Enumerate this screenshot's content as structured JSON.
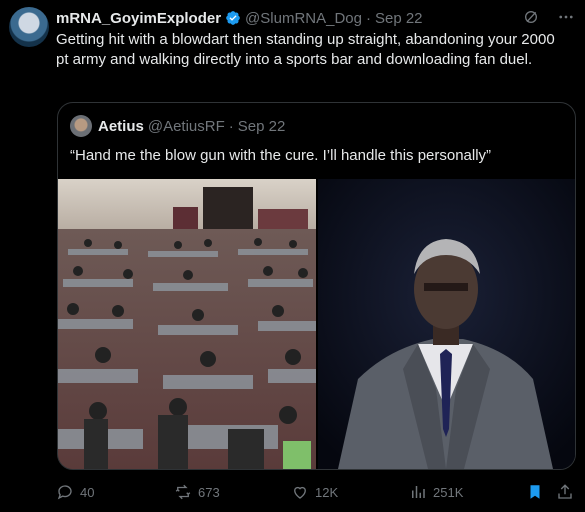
{
  "tweet": {
    "display_name": "mRNA_GoyimExploder",
    "handle": "@SlumRNA_Dog",
    "separator": "·",
    "date": "Sep 22",
    "text": "Getting hit with a blowdart then standing up straight, abandoning your 2000 pt army and walking directly into a sports bar and downloading fan duel."
  },
  "quote": {
    "display_name": "Aetius",
    "handle": "@AetiusRF",
    "separator": "·",
    "date": "Sep 22",
    "text": "“Hand me the blow gun with the cure. I’ll handle this personally”"
  },
  "actions": {
    "replies": "40",
    "reposts": "673",
    "likes": "12K",
    "views": "251K"
  },
  "colors": {
    "background": "#000000",
    "text": "#e7e9ea",
    "muted": "#71767b",
    "verified": "#1d9bf0",
    "bookmark_active": "#1d9bf0"
  },
  "icons": [
    "verified-badge-icon",
    "grok-icon",
    "more-icon",
    "reply-icon",
    "repost-icon",
    "like-icon",
    "views-icon",
    "bookmark-icon",
    "share-icon"
  ]
}
